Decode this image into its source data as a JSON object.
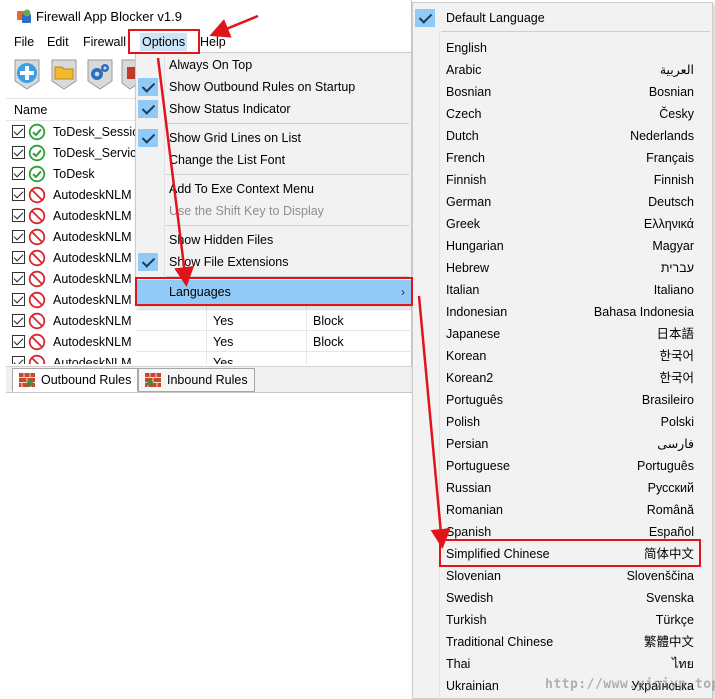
{
  "window": {
    "title": "Firewall App Blocker v1.9"
  },
  "menubar": {
    "items": [
      {
        "label": "File"
      },
      {
        "label": "Edit"
      },
      {
        "label": "Firewall"
      },
      {
        "label": "Options"
      },
      {
        "label": "Help"
      }
    ]
  },
  "toolbar": {
    "buttons": [
      {
        "icon": "add-icon"
      },
      {
        "icon": "folder-icon"
      },
      {
        "icon": "settings-icon"
      },
      {
        "icon": "delete-icon"
      }
    ]
  },
  "list": {
    "column_name": "Name",
    "rows": [
      {
        "name": "ToDesk_Session",
        "status": "allowed",
        "enabled": "",
        "action": ""
      },
      {
        "name": "ToDesk_Service",
        "status": "allowed",
        "enabled": "",
        "action": ""
      },
      {
        "name": "ToDesk",
        "status": "allowed",
        "enabled": "",
        "action": ""
      },
      {
        "name": "AutodeskNLM",
        "status": "blocked",
        "enabled": "",
        "action": ""
      },
      {
        "name": "AutodeskNLM",
        "status": "blocked",
        "enabled": "",
        "action": ""
      },
      {
        "name": "AutodeskNLM",
        "status": "blocked",
        "enabled": "",
        "action": ""
      },
      {
        "name": "AutodeskNLM",
        "status": "blocked",
        "enabled": "",
        "action": ""
      },
      {
        "name": "AutodeskNLM",
        "status": "blocked",
        "enabled": "",
        "action": ""
      },
      {
        "name": "AutodeskNLM",
        "status": "blocked",
        "enabled": "",
        "action": ""
      },
      {
        "name": "AutodeskNLM",
        "status": "blocked",
        "enabled": "Yes",
        "action": "Block"
      },
      {
        "name": "AutodeskNLM",
        "status": "blocked",
        "enabled": "Yes",
        "action": "Block"
      },
      {
        "name": "AutodeskNLM",
        "status": "blocked",
        "enabled": "Yes",
        "action": ""
      }
    ]
  },
  "tabs": [
    {
      "label": "Outbound Rules",
      "active": true
    },
    {
      "label": "Inbound Rules",
      "active": false
    }
  ],
  "options_menu": {
    "items": [
      {
        "label": "Always On Top",
        "checked": false,
        "disabled": false
      },
      {
        "label": "Show Outbound Rules on Startup",
        "checked": true,
        "disabled": false
      },
      {
        "label": "Show Status Indicator",
        "checked": true,
        "disabled": false
      },
      {
        "label": "Show Grid Lines on List",
        "checked": true,
        "disabled": false
      },
      {
        "label": "Change the List Font",
        "checked": false,
        "disabled": false
      },
      {
        "label": "Add To Exe Context Menu",
        "checked": false,
        "disabled": false
      },
      {
        "label": "Use the Shift Key to Display",
        "checked": false,
        "disabled": true
      },
      {
        "label": "Show Hidden Files",
        "checked": false,
        "disabled": false
      },
      {
        "label": "Show File Extensions",
        "checked": true,
        "disabled": false
      },
      {
        "label": "Languages",
        "checked": false,
        "disabled": false,
        "submenu_arrow": "›"
      }
    ]
  },
  "languages_menu": {
    "default": {
      "label": "Default Language",
      "checked": true
    },
    "items": [
      {
        "en": "English",
        "native": ""
      },
      {
        "en": "Arabic",
        "native": "العربية"
      },
      {
        "en": "Bosnian",
        "native": "Bosnian"
      },
      {
        "en": "Czech",
        "native": "Česky"
      },
      {
        "en": "Dutch",
        "native": "Nederlands"
      },
      {
        "en": "French",
        "native": "Français"
      },
      {
        "en": "Finnish",
        "native": "Finnish"
      },
      {
        "en": "German",
        "native": "Deutsch"
      },
      {
        "en": "Greek",
        "native": "Ελληνικά"
      },
      {
        "en": "Hungarian",
        "native": "Magyar"
      },
      {
        "en": "Hebrew",
        "native": "עברית"
      },
      {
        "en": "Italian",
        "native": "Italiano"
      },
      {
        "en": "Indonesian",
        "native": "Bahasa Indonesia"
      },
      {
        "en": "Japanese",
        "native": "日本語"
      },
      {
        "en": "Korean",
        "native": "한국어"
      },
      {
        "en": "Korean2",
        "native": "한국어"
      },
      {
        "en": "Português",
        "native": "Brasileiro"
      },
      {
        "en": "Polish",
        "native": "Polski"
      },
      {
        "en": "Persian",
        "native": "فارسی"
      },
      {
        "en": "Portuguese",
        "native": "Português"
      },
      {
        "en": "Russian",
        "native": "Русский"
      },
      {
        "en": "Romanian",
        "native": "Română"
      },
      {
        "en": "Spanish",
        "native": "Español"
      },
      {
        "en": "Simplified Chinese",
        "native": "简体中文"
      },
      {
        "en": "Slovenian",
        "native": "Slovenščina"
      },
      {
        "en": "Swedish",
        "native": "Svenska"
      },
      {
        "en": "Turkish",
        "native": "Türkçe"
      },
      {
        "en": "Traditional Chinese",
        "native": "繁體中文"
      },
      {
        "en": "Thai",
        "native": "ไทย"
      },
      {
        "en": "Ukrainian",
        "native": "Українська"
      }
    ]
  },
  "watermark": {
    "text": "http://www.yjoiyp.top"
  },
  "colors": {
    "highlight": "#91c9f7",
    "annotation_red": "#e1141b",
    "allowed_green": "#2e9e3a",
    "blocked_red": "#d9262c"
  }
}
